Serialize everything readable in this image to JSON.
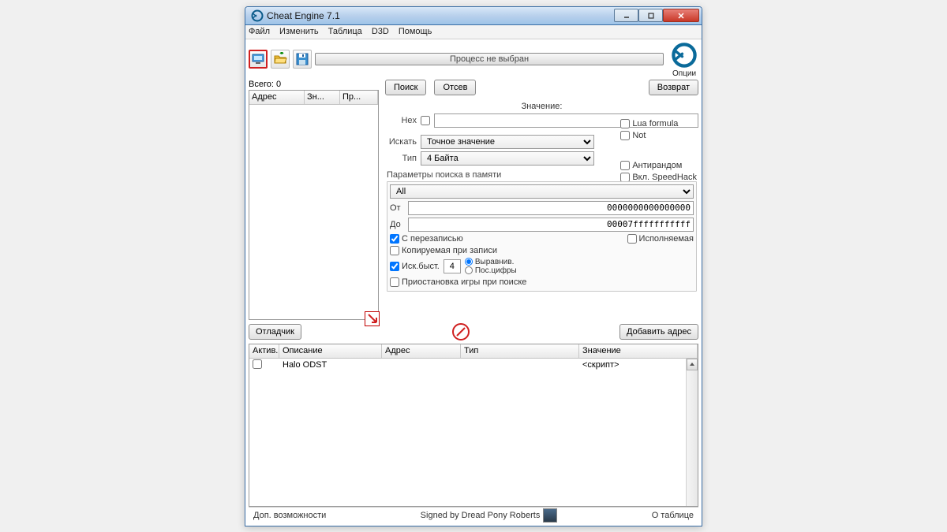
{
  "window": {
    "title": "Cheat Engine 7.1"
  },
  "menu": {
    "file": "Файл",
    "edit": "Изменить",
    "table": "Таблица",
    "d3d": "D3D",
    "help": "Помощь"
  },
  "toolbar": {
    "process_status": "Процесс не выбран",
    "options": "Опции"
  },
  "results": {
    "total_label": "Всего:",
    "total_value": "0",
    "cols": {
      "addr": "Адрес",
      "val": "Зн...",
      "prev": "Пр..."
    }
  },
  "search": {
    "btn_search": "Поиск",
    "btn_filter": "Отсев",
    "btn_undo": "Возврат",
    "value_label": "Значение:",
    "hex_label": "Hex",
    "scan_label": "Искать",
    "scan_value": "Точное значение",
    "type_label": "Тип",
    "type_value": "4 Байта",
    "lua_formula": "Lua formula",
    "not_label": "Not",
    "mem_title": "Параметры поиска в памяти",
    "region_value": "All",
    "from_label": "От",
    "from_value": "0000000000000000",
    "to_label": "До",
    "to_value": "00007fffffffffff",
    "writable": "С перезаписью",
    "executable": "Исполняемая",
    "copy_on_write": "Копируемая при записи",
    "fastscan": "Иск.быст.",
    "fastscan_value": "4",
    "aligned": "Выравнив.",
    "lastdigits": "Пос.цифры",
    "antirandom": "Антирандом",
    "speedhack": "Вкл. SpeedHack",
    "pause_label": "Приостановка игры при поиске"
  },
  "mid": {
    "debugger": "Отладчик",
    "add_address": "Добавить адрес"
  },
  "cheat_table": {
    "cols": {
      "active": "Актив.",
      "desc": "Описание",
      "addr": "Адрес",
      "type": "Тип",
      "value": "Значение"
    },
    "rows": [
      {
        "active": false,
        "desc": "Halo ODST",
        "addr": "",
        "type": "",
        "value": "<скрипт>"
      }
    ]
  },
  "status": {
    "extra": "Доп. возможности",
    "signed": "Signed by Dread Pony Roberts",
    "about": "О таблице"
  }
}
